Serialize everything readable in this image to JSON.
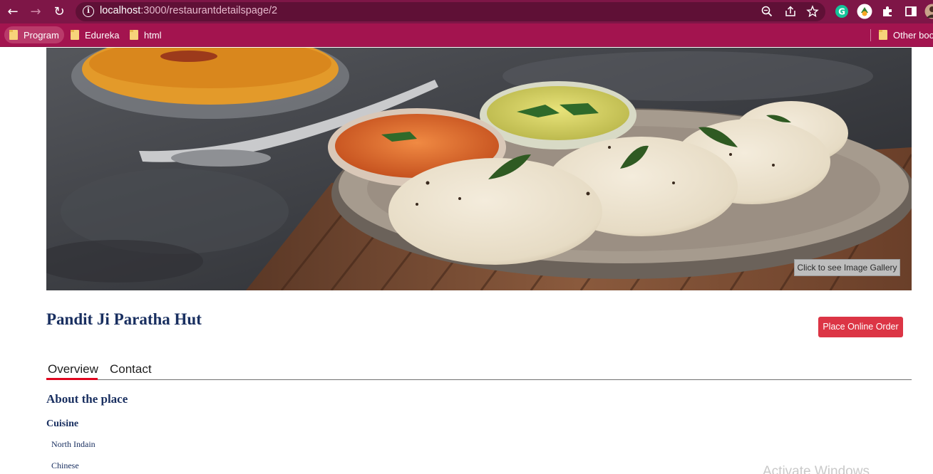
{
  "browser": {
    "url_host": "localhost",
    "url_path": ":3000/restaurantdetailspage/2",
    "bookmarks": [
      {
        "label": "Program"
      },
      {
        "label": "Edureka"
      },
      {
        "label": "html"
      }
    ],
    "other_bookmarks": "Other boo"
  },
  "hero": {
    "gallery_button": "Click to see Image Gallery"
  },
  "restaurant": {
    "name": "Pandit Ji Paratha Hut",
    "order_button": "Place Online Order"
  },
  "tabs": [
    {
      "label": "Overview",
      "active": true
    },
    {
      "label": "Contact",
      "active": false
    }
  ],
  "overview": {
    "about_heading": "About the place",
    "cuisine_heading": "Cuisine",
    "cuisines": [
      "North Indain",
      "Chinese"
    ]
  },
  "watermark": "Activate Windows",
  "colors": {
    "title_bar": "#7e1647",
    "bookmarks_bar": "#a3144f",
    "heading": "#192f60",
    "order_button": "#dc3545",
    "tab_indicator": "#e0061f"
  }
}
